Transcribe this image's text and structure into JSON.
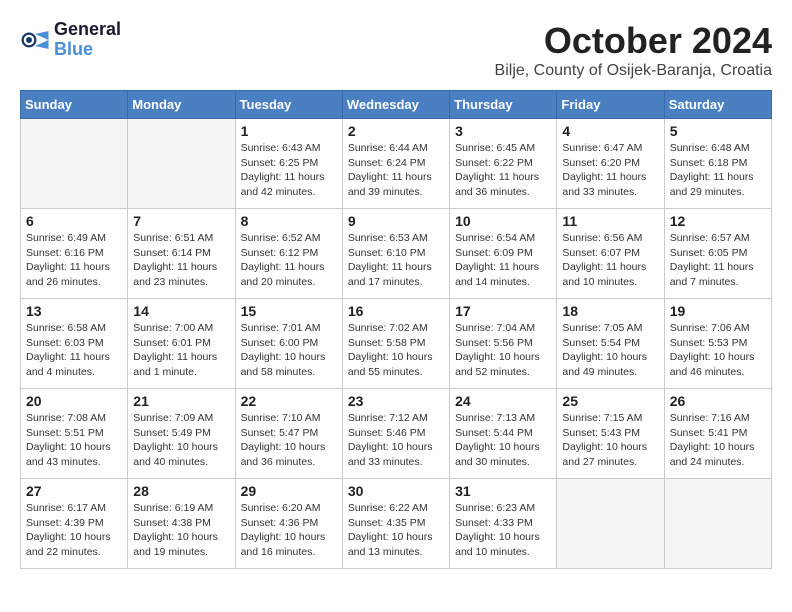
{
  "header": {
    "logo": {
      "general": "General",
      "blue": "Blue"
    },
    "title": "October 2024",
    "location": "Bilje, County of Osijek-Baranja, Croatia"
  },
  "weekdays": [
    "Sunday",
    "Monday",
    "Tuesday",
    "Wednesday",
    "Thursday",
    "Friday",
    "Saturday"
  ],
  "weeks": [
    [
      {
        "day": "",
        "info": ""
      },
      {
        "day": "",
        "info": ""
      },
      {
        "day": "1",
        "info": "Sunrise: 6:43 AM\nSunset: 6:25 PM\nDaylight: 11 hours and 42 minutes."
      },
      {
        "day": "2",
        "info": "Sunrise: 6:44 AM\nSunset: 6:24 PM\nDaylight: 11 hours and 39 minutes."
      },
      {
        "day": "3",
        "info": "Sunrise: 6:45 AM\nSunset: 6:22 PM\nDaylight: 11 hours and 36 minutes."
      },
      {
        "day": "4",
        "info": "Sunrise: 6:47 AM\nSunset: 6:20 PM\nDaylight: 11 hours and 33 minutes."
      },
      {
        "day": "5",
        "info": "Sunrise: 6:48 AM\nSunset: 6:18 PM\nDaylight: 11 hours and 29 minutes."
      }
    ],
    [
      {
        "day": "6",
        "info": "Sunrise: 6:49 AM\nSunset: 6:16 PM\nDaylight: 11 hours and 26 minutes."
      },
      {
        "day": "7",
        "info": "Sunrise: 6:51 AM\nSunset: 6:14 PM\nDaylight: 11 hours and 23 minutes."
      },
      {
        "day": "8",
        "info": "Sunrise: 6:52 AM\nSunset: 6:12 PM\nDaylight: 11 hours and 20 minutes."
      },
      {
        "day": "9",
        "info": "Sunrise: 6:53 AM\nSunset: 6:10 PM\nDaylight: 11 hours and 17 minutes."
      },
      {
        "day": "10",
        "info": "Sunrise: 6:54 AM\nSunset: 6:09 PM\nDaylight: 11 hours and 14 minutes."
      },
      {
        "day": "11",
        "info": "Sunrise: 6:56 AM\nSunset: 6:07 PM\nDaylight: 11 hours and 10 minutes."
      },
      {
        "day": "12",
        "info": "Sunrise: 6:57 AM\nSunset: 6:05 PM\nDaylight: 11 hours and 7 minutes."
      }
    ],
    [
      {
        "day": "13",
        "info": "Sunrise: 6:58 AM\nSunset: 6:03 PM\nDaylight: 11 hours and 4 minutes."
      },
      {
        "day": "14",
        "info": "Sunrise: 7:00 AM\nSunset: 6:01 PM\nDaylight: 11 hours and 1 minute."
      },
      {
        "day": "15",
        "info": "Sunrise: 7:01 AM\nSunset: 6:00 PM\nDaylight: 10 hours and 58 minutes."
      },
      {
        "day": "16",
        "info": "Sunrise: 7:02 AM\nSunset: 5:58 PM\nDaylight: 10 hours and 55 minutes."
      },
      {
        "day": "17",
        "info": "Sunrise: 7:04 AM\nSunset: 5:56 PM\nDaylight: 10 hours and 52 minutes."
      },
      {
        "day": "18",
        "info": "Sunrise: 7:05 AM\nSunset: 5:54 PM\nDaylight: 10 hours and 49 minutes."
      },
      {
        "day": "19",
        "info": "Sunrise: 7:06 AM\nSunset: 5:53 PM\nDaylight: 10 hours and 46 minutes."
      }
    ],
    [
      {
        "day": "20",
        "info": "Sunrise: 7:08 AM\nSunset: 5:51 PM\nDaylight: 10 hours and 43 minutes."
      },
      {
        "day": "21",
        "info": "Sunrise: 7:09 AM\nSunset: 5:49 PM\nDaylight: 10 hours and 40 minutes."
      },
      {
        "day": "22",
        "info": "Sunrise: 7:10 AM\nSunset: 5:47 PM\nDaylight: 10 hours and 36 minutes."
      },
      {
        "day": "23",
        "info": "Sunrise: 7:12 AM\nSunset: 5:46 PM\nDaylight: 10 hours and 33 minutes."
      },
      {
        "day": "24",
        "info": "Sunrise: 7:13 AM\nSunset: 5:44 PM\nDaylight: 10 hours and 30 minutes."
      },
      {
        "day": "25",
        "info": "Sunrise: 7:15 AM\nSunset: 5:43 PM\nDaylight: 10 hours and 27 minutes."
      },
      {
        "day": "26",
        "info": "Sunrise: 7:16 AM\nSunset: 5:41 PM\nDaylight: 10 hours and 24 minutes."
      }
    ],
    [
      {
        "day": "27",
        "info": "Sunrise: 6:17 AM\nSunset: 4:39 PM\nDaylight: 10 hours and 22 minutes."
      },
      {
        "day": "28",
        "info": "Sunrise: 6:19 AM\nSunset: 4:38 PM\nDaylight: 10 hours and 19 minutes."
      },
      {
        "day": "29",
        "info": "Sunrise: 6:20 AM\nSunset: 4:36 PM\nDaylight: 10 hours and 16 minutes."
      },
      {
        "day": "30",
        "info": "Sunrise: 6:22 AM\nSunset: 4:35 PM\nDaylight: 10 hours and 13 minutes."
      },
      {
        "day": "31",
        "info": "Sunrise: 6:23 AM\nSunset: 4:33 PM\nDaylight: 10 hours and 10 minutes."
      },
      {
        "day": "",
        "info": ""
      },
      {
        "day": "",
        "info": ""
      }
    ]
  ]
}
